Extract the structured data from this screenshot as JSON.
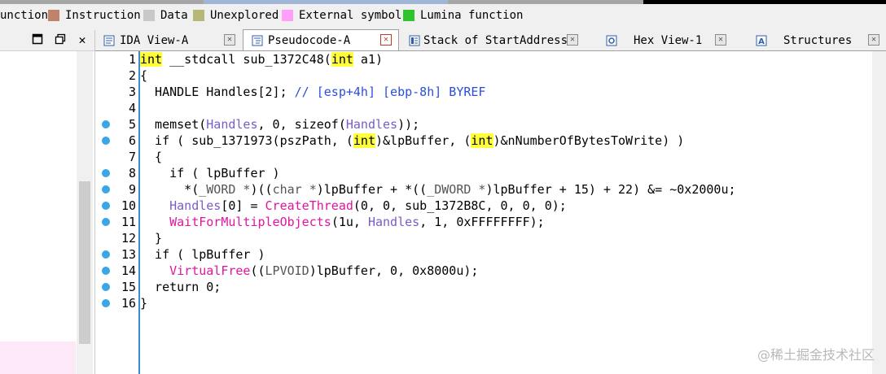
{
  "legend": {
    "items": [
      {
        "label": "unction",
        "color": ""
      },
      {
        "label": "Instruction",
        "color": "#c1826a"
      },
      {
        "label": "Data",
        "color": "#c8c8c8"
      },
      {
        "label": "Unexplored",
        "color": "#b7b777"
      },
      {
        "label": "External symbol",
        "color": "#ff9ff7"
      },
      {
        "label": "Lumina function",
        "color": "#2dc42d"
      }
    ]
  },
  "tabs": [
    {
      "label": "IDA View-A",
      "icon": "ida-view-icon",
      "active": false
    },
    {
      "label": "Pseudocode-A",
      "icon": "pseudocode-icon",
      "active": true
    },
    {
      "label": "Stack of StartAddress",
      "icon": "stack-icon",
      "active": false
    },
    {
      "label": "Hex View-1",
      "icon": "hex-view-icon",
      "active": false
    },
    {
      "label": "Structures",
      "icon": "structures-icon",
      "active": false
    }
  ],
  "code": [
    {
      "n": "1",
      "bp": false
    },
    {
      "n": "2",
      "bp": false
    },
    {
      "n": "3",
      "bp": false
    },
    {
      "n": "4",
      "bp": false
    },
    {
      "n": "5",
      "bp": true
    },
    {
      "n": "6",
      "bp": true
    },
    {
      "n": "7",
      "bp": false
    },
    {
      "n": "8",
      "bp": true
    },
    {
      "n": "9",
      "bp": true
    },
    {
      "n": "10",
      "bp": true
    },
    {
      "n": "11",
      "bp": true
    },
    {
      "n": "12",
      "bp": false
    },
    {
      "n": "13",
      "bp": true
    },
    {
      "n": "14",
      "bp": true
    },
    {
      "n": "15",
      "bp": true
    },
    {
      "n": "16",
      "bp": true
    }
  ],
  "code_text": {
    "l1": {
      "a": "int",
      "b": " __stdcall sub_1372C48(",
      "c": "int",
      "d": " a1)"
    },
    "l2": "{",
    "l3": {
      "a": "  HANDLE Handles[2]; ",
      "b": "// [esp+4h] [ebp-8h] BYREF"
    },
    "l5": {
      "a": "  memset(",
      "b": "Handles",
      "c": ", 0, sizeof(",
      "d": "Handles",
      "e": "));"
    },
    "l6": {
      "a": "  if ( sub_1371973(pszPath, (",
      "b": "int",
      "c": ")&lpBuffer, (",
      "d": "int",
      "e": ")&nNumberOfBytesToWrite) )"
    },
    "l7": "  {",
    "l8": "    if ( lpBuffer )",
    "l9": {
      "a": "      *(",
      "b": "_WORD *",
      "c": ")((",
      "d": "char *",
      "e": ")lpBuffer + *((",
      "f": "_DWORD *",
      "g": ")lpBuffer + 15) + 22) &= ~0x2000u;"
    },
    "l10": {
      "a": "    ",
      "b": "Handles",
      "c": "[0] = ",
      "d": "CreateThread",
      "e": "(0, 0, sub_1372B8C, 0, 0, 0);"
    },
    "l11": {
      "a": "    ",
      "b": "WaitForMultipleObjects",
      "c": "(1u, ",
      "d": "Handles",
      "e": ", 1, 0xFFFFFFFF);"
    },
    "l12": "  }",
    "l13": "  if ( lpBuffer )",
    "l14": {
      "a": "    ",
      "b": "VirtualFree",
      "c": "((",
      "d": "LPVOID",
      "e": ")lpBuffer, 0, 0x8000u);"
    },
    "l15": "  return 0;",
    "l16": "}"
  },
  "watermark": "@稀土掘金技术社区"
}
